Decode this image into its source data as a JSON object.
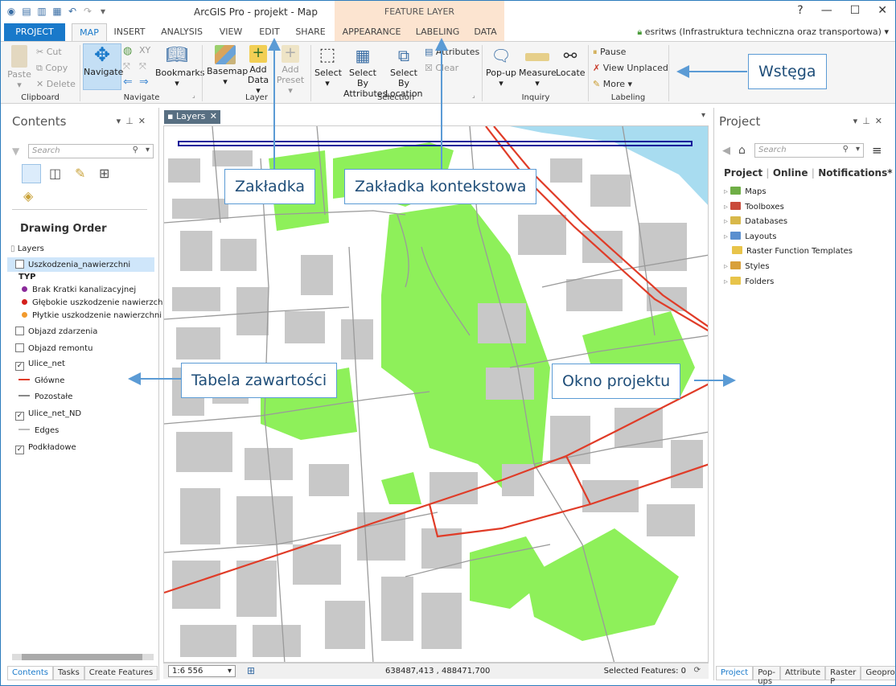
{
  "title": {
    "app": "ArcGIS Pro - projekt - Map",
    "context": "FEATURE LAYER",
    "help": "?",
    "minimize": "—",
    "maximize": "☐",
    "close": "✕"
  },
  "tabs": {
    "project": "PROJECT",
    "map": "MAP",
    "insert": "INSERT",
    "analysis": "ANALYSIS",
    "view": "VIEW",
    "edit": "EDIT",
    "share": "SHARE",
    "appearance": "APPEARANCE",
    "labeling": "LABELING",
    "data": "DATA"
  },
  "account": "esritws (Infrastruktura techniczna oraz transportowa) ▾",
  "ribbon": {
    "clipboard": {
      "label": "Clipboard",
      "paste": "Paste",
      "cut": "Cut",
      "copy": "Copy",
      "delete": "Delete"
    },
    "navigate": {
      "label": "Navigate",
      "navigate": "Navigate",
      "bookmarks": "Bookmarks"
    },
    "layer": {
      "label": "Layer",
      "basemap": "Basemap",
      "add_data_1": "Add",
      "add_data_2": "Data ▾",
      "add_preset_1": "Add",
      "add_preset_2": "Preset ▾"
    },
    "selection": {
      "label": "Selection",
      "select": "Select",
      "select_by_attr_1": "Select By",
      "select_by_attr_2": "Attributes",
      "select_by_loc_1": "Select By",
      "select_by_loc_2": "Location",
      "attributes": "Attributes",
      "clear": "Clear"
    },
    "inquiry": {
      "label": "Inquiry",
      "popup": "Pop-up",
      "measure": "Measure",
      "locate": "Locate"
    },
    "labeling": {
      "label": "Labeling",
      "pause": "Pause",
      "view_unplaced": "View Unplaced",
      "more": "More ▾"
    }
  },
  "contents": {
    "title": "Contents",
    "search_placeholder": "Search",
    "drawing_order": "Drawing Order",
    "layers": "Layers",
    "items": {
      "uszkodzenia": "Uszkodzenia_nawierzchni",
      "typ": "TYP",
      "brak": "Brak Kratki kanalizacyjnej",
      "glebokie": "Głębokie uszkodzenie nawierzchni",
      "plytkie": "Płytkie uszkodzenie nawierzchni",
      "objazd_zdarzenia": "Objazd zdarzenia",
      "objazd_remontu": "Objazd remontu",
      "ulice_net": "Ulice_net",
      "glowne": "Główne",
      "pozostale": "Pozostałe",
      "ulice_net_nd": "Ulice_net_ND",
      "edges": "Edges",
      "podkladowe": "Podkładowe"
    },
    "bottom_tabs": [
      "Contents",
      "Tasks",
      "Create Features"
    ]
  },
  "map": {
    "tab": "Layers",
    "scale": "1:6 556",
    "coordinates": "638487,413 , 488471,700",
    "selected": "Selected Features: 0"
  },
  "project": {
    "title": "Project",
    "search_placeholder": "Search",
    "tabs": [
      "Project",
      "Online",
      "Notifications*"
    ],
    "items": [
      "Maps",
      "Toolboxes",
      "Databases",
      "Layouts",
      "Raster Function Templates",
      "Styles",
      "Folders"
    ],
    "bottom_tabs": [
      "Project",
      "Pop-ups",
      "Attribute",
      "Raster P",
      "Geoproce"
    ]
  },
  "callouts": {
    "wstega": "Wstęga",
    "zakladka": "Zakładka",
    "zakladka_kontekstowa": "Zakładka kontekstowa",
    "tabela": "Tabela zawartości",
    "okno": "Okno projektu"
  },
  "colors": {
    "accent": "#1979ca",
    "context_tab": "#fce4d0",
    "park": "#8ef05a",
    "water": "#a8dcf0",
    "building": "#c8c8c8",
    "main_road": "#e03c28",
    "callout_border": "#5b9bd5"
  }
}
